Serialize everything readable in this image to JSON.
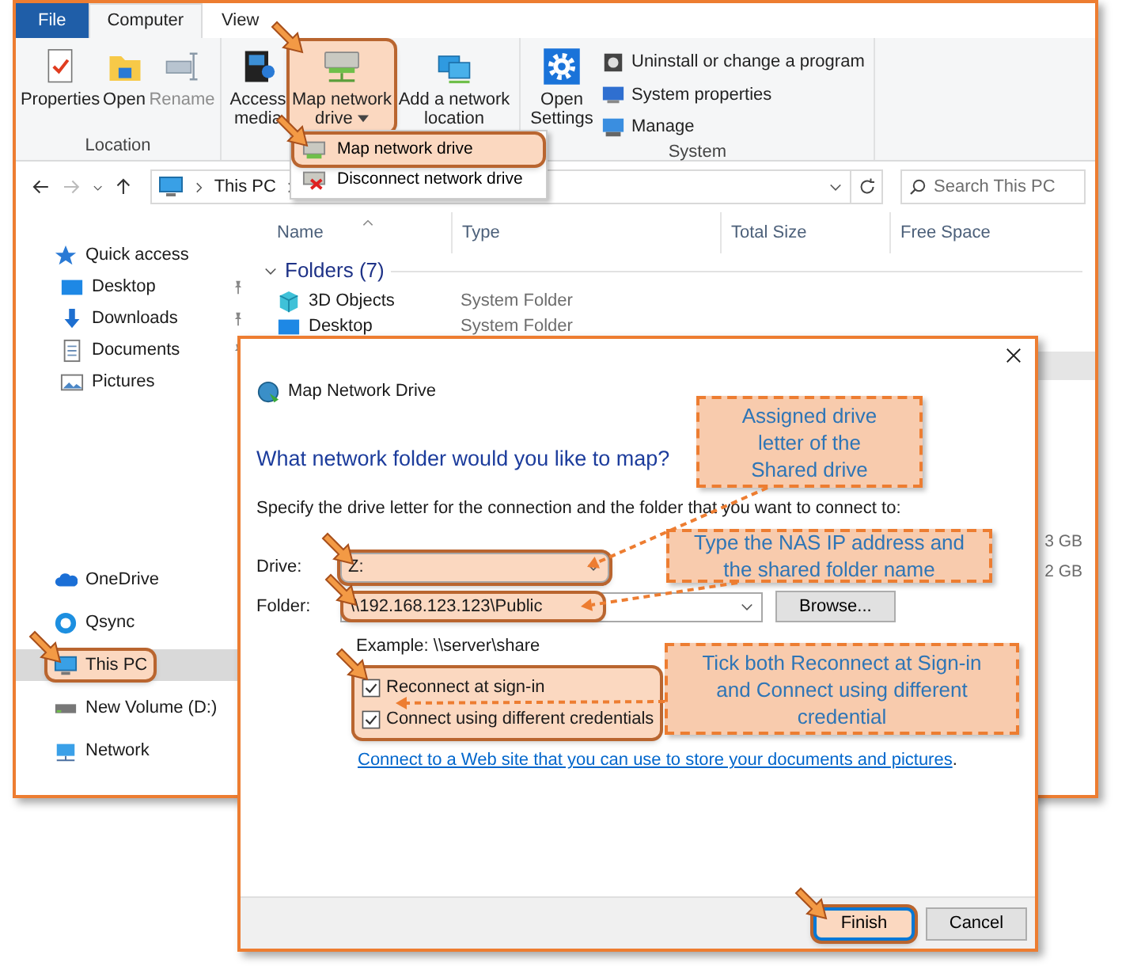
{
  "explorer": {
    "ribbon_tabs": [
      {
        "label": "File",
        "kind": "file",
        "selected": false
      },
      {
        "label": "Computer",
        "kind": "tab",
        "selected": true
      },
      {
        "label": "View",
        "kind": "tab",
        "selected": false
      }
    ],
    "ribbon_groups": [
      {
        "label": "Location",
        "buttons": [
          {
            "label": "Properties",
            "disabled": false,
            "highlighted": false,
            "dropdown": false
          },
          {
            "label": "Open",
            "disabled": false,
            "highlighted": false,
            "dropdown": false
          },
          {
            "label": "Rename",
            "disabled": true,
            "highlighted": false,
            "dropdown": false
          }
        ]
      },
      {
        "buttons": [
          {
            "label": "Access media",
            "disabled": false,
            "highlighted": false,
            "dropdown": false
          },
          {
            "label": "Map network drive",
            "disabled": false,
            "highlighted": true,
            "dropdown": true
          },
          {
            "label": "Add a network location",
            "disabled": false,
            "highlighted": false,
            "dropdown": false
          }
        ]
      },
      {
        "label": "System",
        "buttons": [
          {
            "label": "Open Settings",
            "disabled": false,
            "highlighted": false,
            "dropdown": false
          }
        ],
        "small_buttons": [
          {
            "label": "Uninstall or change a program"
          },
          {
            "label": "System properties"
          },
          {
            "label": "Manage"
          }
        ]
      }
    ],
    "dropdown_menu": [
      {
        "label": "Map network drive",
        "highlighted": true
      },
      {
        "label": "Disconnect network drive",
        "highlighted": false
      }
    ],
    "address_bar": {
      "path": "This PC"
    },
    "search": {
      "placeholder": "Search This PC"
    },
    "sidebar": {
      "sections": [
        {
          "items": [
            {
              "label": "Quick access",
              "selected": false,
              "highlighted": false,
              "pinned": false
            },
            {
              "label": "Desktop",
              "selected": false,
              "highlighted": false,
              "pinned": true
            },
            {
              "label": "Downloads",
              "selected": false,
              "highlighted": false,
              "pinned": true
            },
            {
              "label": "Documents",
              "selected": false,
              "highlighted": false,
              "pinned": true
            },
            {
              "label": "Pictures",
              "selected": false,
              "highlighted": false,
              "pinned": false
            }
          ]
        },
        {
          "items": [
            {
              "label": "OneDrive",
              "selected": false,
              "highlighted": false,
              "pinned": false
            },
            {
              "label": "Qsync",
              "selected": false,
              "highlighted": false,
              "pinned": false
            },
            {
              "label": "This PC",
              "selected": true,
              "highlighted": true,
              "pinned": false
            },
            {
              "label": "New Volume (D:)",
              "selected": false,
              "highlighted": false,
              "pinned": false
            },
            {
              "label": "Network",
              "selected": false,
              "highlighted": false,
              "pinned": false
            }
          ]
        }
      ]
    },
    "columns": [
      "Name",
      "Type",
      "Total Size",
      "Free Space"
    ],
    "group": {
      "label": "Folders (7)",
      "expanded": true,
      "rows": [
        {
          "name": "3D Objects",
          "type": "System Folder",
          "selected": false
        },
        {
          "name": "Desktop",
          "type": "System Folder",
          "selected": false
        },
        {
          "selected": true
        }
      ]
    },
    "free_space_readings": [
      "3 GB",
      "2 GB"
    ]
  },
  "dialog": {
    "title": "Map Network Drive",
    "heading": "What network folder would you like to map?",
    "instruction": "Specify the drive letter for the connection and the folder that you want to connect to:",
    "drive": {
      "label": "Drive:",
      "value": "Z:",
      "highlighted": true
    },
    "folder": {
      "label": "Folder:",
      "value": "\\\\192.168.123.123\\Public",
      "highlighted": true
    },
    "browse_button": "Browse...",
    "example": "Example: \\\\server\\share",
    "checkboxes": [
      {
        "label": "Reconnect at sign-in",
        "checked": true
      },
      {
        "label": "Connect using different credentials",
        "checked": true
      }
    ],
    "checkboxes_highlighted": true,
    "link": "Connect to a Web site that you can use to store your documents and pictures",
    "link_suffix": ".",
    "buttons": [
      {
        "label": "Finish",
        "kind": "primary",
        "highlighted": true
      },
      {
        "label": "Cancel",
        "kind": "secondary",
        "highlighted": false
      }
    ]
  },
  "callouts": [
    {
      "text": "Assigned drive letter of the Shared drive"
    },
    {
      "text": "Type the NAS IP address and the shared folder name"
    },
    {
      "text": "Tick both Reconnect at Sign-in and Connect using different credential"
    }
  ]
}
